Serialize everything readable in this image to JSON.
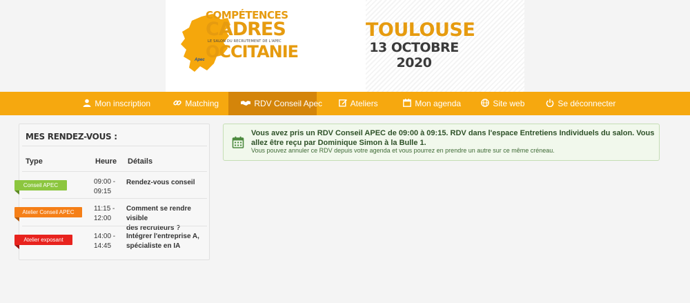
{
  "banner": {
    "logo_line1": "COMPÉTENCES",
    "logo_line2": "CADRES",
    "logo_tagline": "LE SALON DU RECRUTEMENT DE L'APEC",
    "logo_line3": "OCCITANIE",
    "apec_mark": "Apec",
    "city": "TOULOUSE",
    "date": "13 OCTOBRE 2020",
    "colors": {
      "accent": "#e69b0f",
      "dark": "#3a3a3a"
    }
  },
  "nav": {
    "background": "#f6a80f",
    "active_background": "#d4850a",
    "items": [
      {
        "label": "Mon inscription",
        "icon": "user-icon"
      },
      {
        "label": "Matching",
        "icon": "link-icon"
      },
      {
        "label": "RDV Conseil Apec",
        "icon": "handshake-icon",
        "active": true
      },
      {
        "label": "Ateliers",
        "icon": "edit-icon"
      },
      {
        "label": "Mon agenda",
        "icon": "calendar-icon"
      },
      {
        "label": "Site web",
        "icon": "globe-icon"
      },
      {
        "label": "Se déconnecter",
        "icon": "power-icon"
      }
    ]
  },
  "rdv": {
    "title": "MES RENDEZ-VOUS :",
    "columns": [
      "Type",
      "Heure",
      "Détails"
    ],
    "rows": [
      {
        "type": "Conseil APEC",
        "type_color": "#8cc63f",
        "time_start": "09:00 -",
        "time_end": "09:15",
        "details1": "Rendez-vous conseil",
        "details2": ""
      },
      {
        "type": "Atelier Conseil APEC",
        "type_color": "#f57f17",
        "time_start": "11:15 -",
        "time_end": "12:00",
        "details1": "Comment se rendre visible",
        "details2": "des recruteurs ?"
      },
      {
        "type": "Atelier exposant",
        "type_color": "#e8231e",
        "time_start": "14:00 -",
        "time_end": "14:45",
        "details1": "Intégrer l'entreprise A,",
        "details2": "spécialiste en IA"
      }
    ]
  },
  "alert": {
    "icon": "calendar-icon",
    "message": "Vous avez pris un RDV Conseil APEC de 09:00 à 09:15. RDV dans l'espace Entretiens Individuels du salon. Vous allez être reçu par Dominique Simon à la Bulle 1.",
    "sub": "Vous pouvez annuler ce RDV depuis votre agenda et vous pourrez en prendre un autre sur ce même créneau."
  }
}
